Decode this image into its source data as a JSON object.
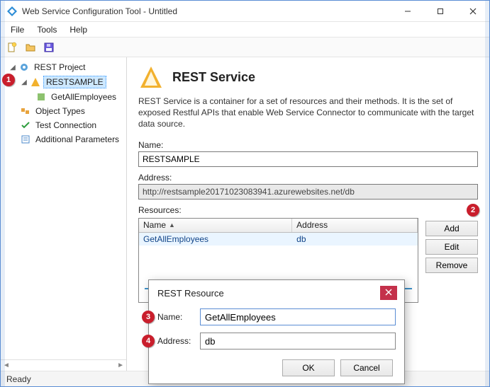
{
  "window": {
    "title": "Web Service Configuration Tool - Untitled"
  },
  "menubar": [
    "File",
    "Tools",
    "Help"
  ],
  "toolbar_icons": [
    "new-file-icon",
    "open-folder-icon",
    "save-icon"
  ],
  "tree": {
    "root_label": "REST Project",
    "sample_label": "RESTSAMPLE",
    "child_label": "GetAllEmployees",
    "object_types": "Object Types",
    "test_conn": "Test Connection",
    "additional_params": "Additional Parameters"
  },
  "panel": {
    "heading": "REST Service",
    "description": "REST Service is a container for a set of resources and their methods. It is the set of exposed Restful APIs that enable Web Service Connector to communicate with the target data source.",
    "name_label": "Name:",
    "name_value": "RESTSAMPLE",
    "address_label": "Address:",
    "address_value": "http://restsample20171023083941.azurewebsites.net/db",
    "resources_label": "Resources:",
    "col_name": "Name",
    "col_address": "Address",
    "res_name": "GetAllEmployees",
    "res_addr": "db",
    "add_btn": "Add",
    "edit_btn": "Edit",
    "remove_btn": "Remove"
  },
  "dialog": {
    "title": "REST Resource",
    "name_label": "Name:",
    "name_value": "GetAllEmployees",
    "address_label": "Address:",
    "address_value": "db",
    "ok": "OK",
    "cancel": "Cancel"
  },
  "statusbar": {
    "status": "Ready"
  },
  "scroll_hints": {
    "left": "◄",
    "right": "►"
  },
  "callouts": {
    "c1": "1",
    "c2": "2",
    "c3": "3",
    "c4": "4"
  }
}
